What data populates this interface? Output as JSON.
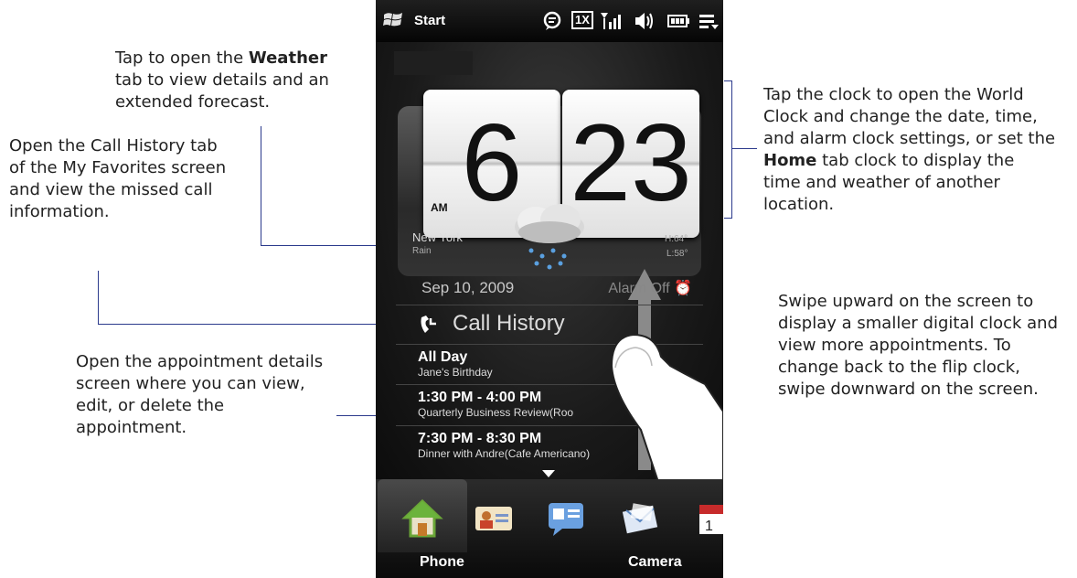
{
  "callouts": {
    "weather": {
      "pre": "Tap to open the ",
      "bold": "Weather",
      "post": " tab to view details and an extended forecast."
    },
    "call_history": {
      "text": "Open the Call History tab of the My Favorites screen and view the missed call information."
    },
    "appointment": {
      "text": "Open the appointment details screen where you can view, edit, or delete the appointment."
    },
    "clock": {
      "pre": "Tap the clock to open the World Clock and change the date, time, and alarm clock settings, or set the ",
      "bold": "Home",
      "post": " tab clock to display the time and weather of another location."
    },
    "swipe": {
      "text": "Swipe upward on the screen to display a smaller digital clock and view more appointments. To change back to the flip clock, swipe downward on the screen."
    }
  },
  "status_bar": {
    "start_label": "Start",
    "network_label": "1X"
  },
  "clock": {
    "hour": "6",
    "minute": "23",
    "ampm": "AM"
  },
  "weather": {
    "city": "New York",
    "condition": "Rain",
    "high": "H:64°",
    "low": "L:58°"
  },
  "date": "Sep 10, 2009",
  "alarm_label": "Alarm Off",
  "call_history_label": "Call History",
  "appointments": [
    {
      "time": "All Day",
      "title": "Jane's Birthday"
    },
    {
      "time": "1:30 PM - 4:00 PM",
      "title": "Quarterly Business Review(Roo"
    },
    {
      "time": "7:30 PM - 8:30 PM",
      "title": "Dinner with Andre(Cafe Americano)"
    }
  ],
  "softkeys": {
    "left": "Phone",
    "right": "Camera"
  },
  "colors": {
    "callout_line": "#2b3a8c",
    "tab_bar": "#111111"
  }
}
